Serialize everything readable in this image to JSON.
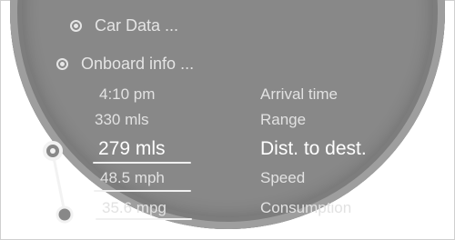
{
  "menu": {
    "car_data": "Car Data ...",
    "onboard_info": "Onboard info ..."
  },
  "rows": [
    {
      "value": "4:10 pm",
      "label": "Arrival time"
    },
    {
      "value": "330 mls",
      "label": "Range"
    },
    {
      "value": "279 mls",
      "label": "Dist. to dest."
    },
    {
      "value": "48.5 mph",
      "label": "Speed"
    },
    {
      "value": "35.6 mpg",
      "label": "Consumption"
    }
  ]
}
